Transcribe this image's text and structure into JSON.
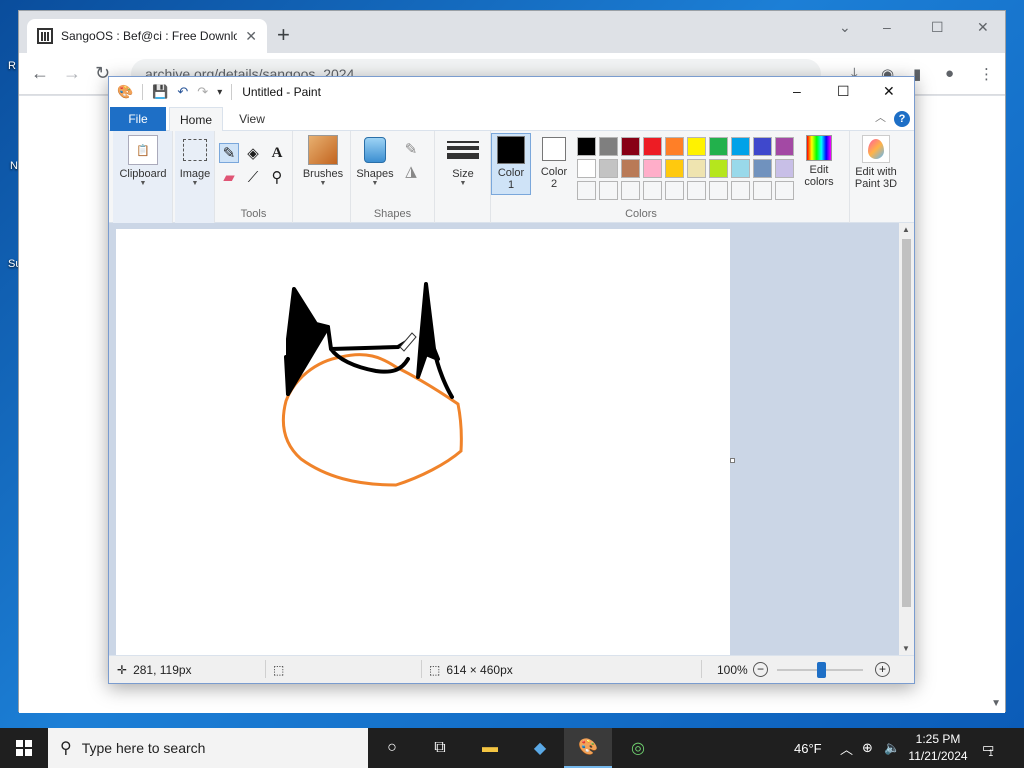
{
  "desktop": {
    "icon_labels": [
      "R",
      "N",
      "Su"
    ]
  },
  "browser": {
    "tab_title": "SangoOS : Bef@ci : Free Downlo",
    "address": "archive.org/details/sangoos_2024",
    "controls": {
      "minimize": "–",
      "maximize": "☐",
      "close": "✕",
      "dropdown": "⌄"
    }
  },
  "paint": {
    "title": "Untitled - Paint",
    "tabs": {
      "file": "File",
      "home": "Home",
      "view": "View"
    },
    "groups": {
      "clipboard": "Clipboard",
      "image": "Image",
      "tools": "Tools",
      "brushes": "Brushes",
      "shapes_btn": "Shapes",
      "shapes": "Shapes",
      "size": "Size",
      "color1": "Color\n1",
      "color1_a": "Color",
      "color1_b": "1",
      "color2_a": "Color",
      "color2_b": "2",
      "colors": "Colors",
      "edit_colors_a": "Edit",
      "edit_colors_b": "colors",
      "paint3d_a": "Edit with",
      "paint3d_b": "Paint 3D"
    },
    "palette_row1": [
      "#000000",
      "#7f7f7f",
      "#880015",
      "#ed1c24",
      "#ff7f27",
      "#fff200",
      "#22b14c",
      "#00a2e8",
      "#3f48cc",
      "#a349a4"
    ],
    "palette_row2": [
      "#ffffff",
      "#c3c3c3",
      "#b97a57",
      "#ffaec9",
      "#ffc90e",
      "#efe4b0",
      "#b5e61d",
      "#99d9ea",
      "#7092be",
      "#c8bfe7"
    ],
    "color1": "#000000",
    "color2": "#ffffff",
    "status": {
      "cursor_pos": "281, 119px",
      "canvas_size": "614 × 460px",
      "zoom": "100%"
    }
  },
  "taskbar": {
    "search_placeholder": "Type here to search",
    "weather": "46°F",
    "time": "1:25 PM",
    "date": "11/21/2024",
    "notification_count": "1"
  }
}
